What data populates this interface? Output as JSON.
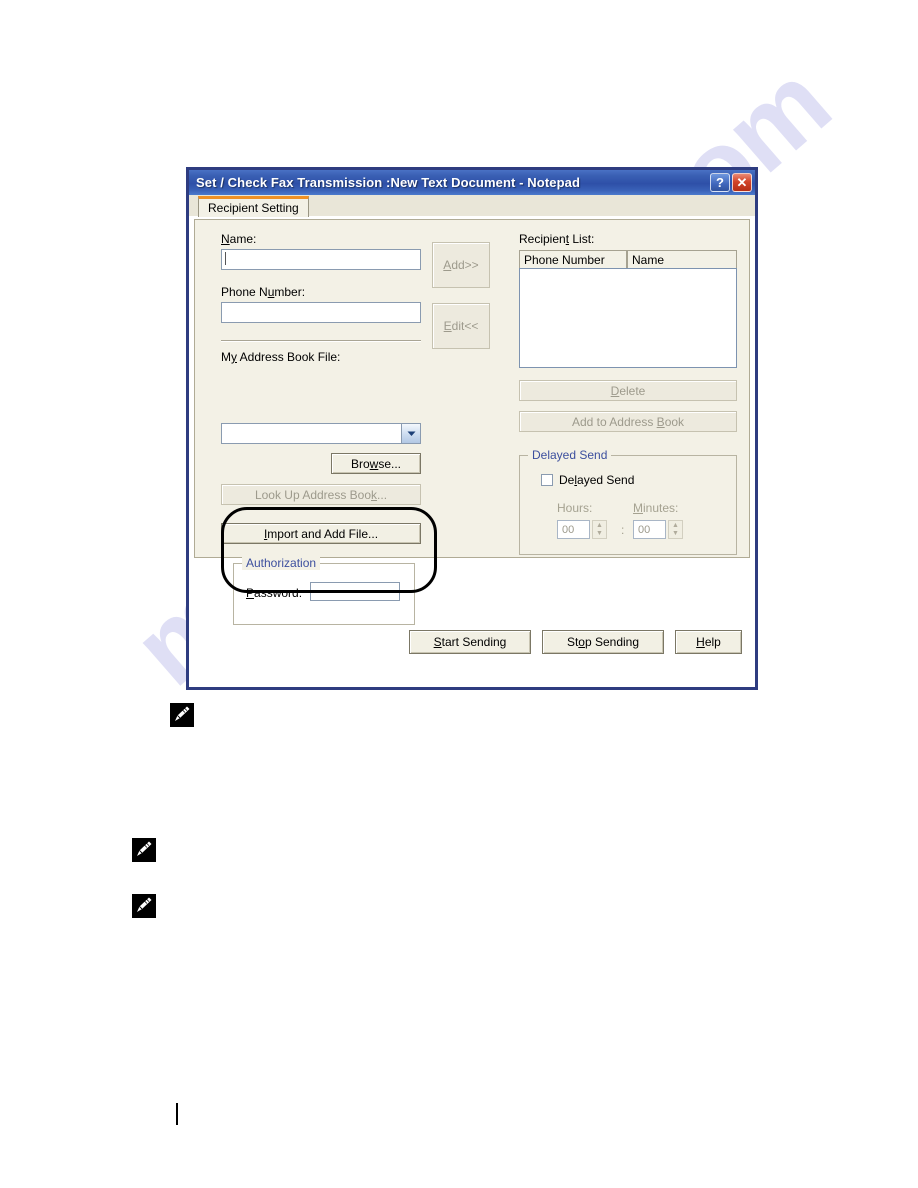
{
  "window": {
    "title": "Set / Check Fax Transmission :New Text Document - Notepad",
    "help_button": "?",
    "close_button": "✕",
    "titlebar_color": "#2e50a8",
    "border_color": "#2e3c80"
  },
  "tabs": [
    {
      "id": "recipient-setting",
      "label": "Recipient Setting",
      "selected": true,
      "accent_color": "#f09124"
    }
  ],
  "left_panel": {
    "name": {
      "label": "Name:",
      "accel": "N",
      "value": "",
      "focused": true
    },
    "phone": {
      "label": "Phone Number:",
      "accel": "u",
      "value": ""
    },
    "address_book_file": {
      "label": "My Address Book File:",
      "accel": "y",
      "value": ""
    },
    "buttons": {
      "browse": {
        "label": "Browse...",
        "accel": "w",
        "enabled": true
      },
      "look_up": {
        "label": "Look Up Address Book...",
        "accel": "k",
        "enabled": false
      },
      "import_add": {
        "label": "Import and Add File...",
        "accel": "I",
        "enabled": true
      }
    },
    "authorization": {
      "legend": "Authorization",
      "password_label": "Password:",
      "password_accel": "P",
      "password_value": "",
      "highlighted": true
    }
  },
  "middle_buttons": [
    {
      "id": "add",
      "label": "Add>>",
      "accel": "A",
      "enabled": false
    },
    {
      "id": "edit",
      "label": "Edit<<",
      "accel": "E",
      "enabled": false
    }
  ],
  "right_panel": {
    "recipient_list": {
      "label": "Recipient List:",
      "accel": "t",
      "columns": [
        "Phone Number",
        "Name"
      ],
      "rows": []
    },
    "buttons": {
      "delete": {
        "label": "Delete",
        "accel": "D",
        "enabled": false
      },
      "add_to_address_book": {
        "label": "Add to Address Book",
        "accel": "B",
        "enabled": false
      }
    },
    "delayed_send": {
      "legend": "Delayed Send",
      "checkbox_label": "Delayed Send",
      "checkbox_accel": "l",
      "checked": false,
      "hours_label": "Hours:",
      "hours_value": "00",
      "minutes_label": "Minutes:",
      "minutes_accel": "M",
      "minutes_value": "00",
      "separator": ":",
      "enabled": false
    }
  },
  "footer_buttons": [
    {
      "id": "start-sending",
      "label": "Start Sending",
      "accel": "S"
    },
    {
      "id": "stop-sending",
      "label": "Stop Sending",
      "accel": "o"
    },
    {
      "id": "help",
      "label": "Help",
      "accel": "H"
    }
  ],
  "page": {
    "watermark": "manualshive.com",
    "note_icons": [
      {
        "id": "note-1"
      },
      {
        "id": "note-2"
      },
      {
        "id": "note-3"
      }
    ]
  }
}
